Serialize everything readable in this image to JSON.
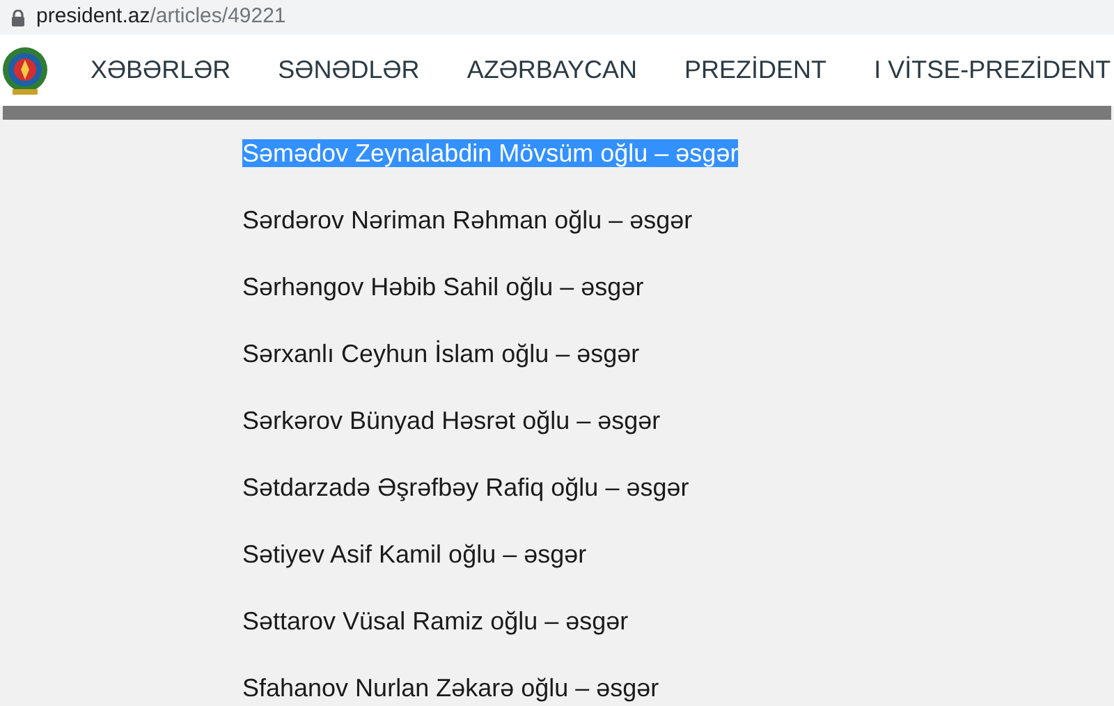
{
  "address_bar": {
    "domain": "president.az",
    "path": "/articles/49221"
  },
  "nav": {
    "items": [
      {
        "label": "XƏBƏRLƏR"
      },
      {
        "label": "SƏNƏDLƏR"
      },
      {
        "label": "AZƏRBAYCAN"
      },
      {
        "label": "PREZİDENT"
      },
      {
        "label": "I VİTSE-PREZİDENT"
      }
    ]
  },
  "names": [
    {
      "text": "Səmədov Zeynalabdin Mövsüm oğlu – əsgər",
      "selected": true
    },
    {
      "text": "Sərdərov Nəriman Rəhman oğlu – əsgər",
      "selected": false
    },
    {
      "text": "Sərhəngov Həbib Sahil oğlu – əsgər",
      "selected": false
    },
    {
      "text": "Sərxanlı Ceyhun İslam oğlu – əsgər",
      "selected": false
    },
    {
      "text": "Sərkərov Bünyad Həsrət oğlu – əsgər",
      "selected": false
    },
    {
      "text": "Sətdarzadə Əşrəfbəy Rafiq oğlu – əsgər",
      "selected": false
    },
    {
      "text": "Sətiyev Asif Kamil oğlu – əsgər",
      "selected": false
    },
    {
      "text": "Səttarov Vüsal Ramiz oğlu – əsgər",
      "selected": false
    },
    {
      "text": "Sfahanov Nurlan Zəkarə oğlu – əsgər",
      "selected": false
    }
  ]
}
